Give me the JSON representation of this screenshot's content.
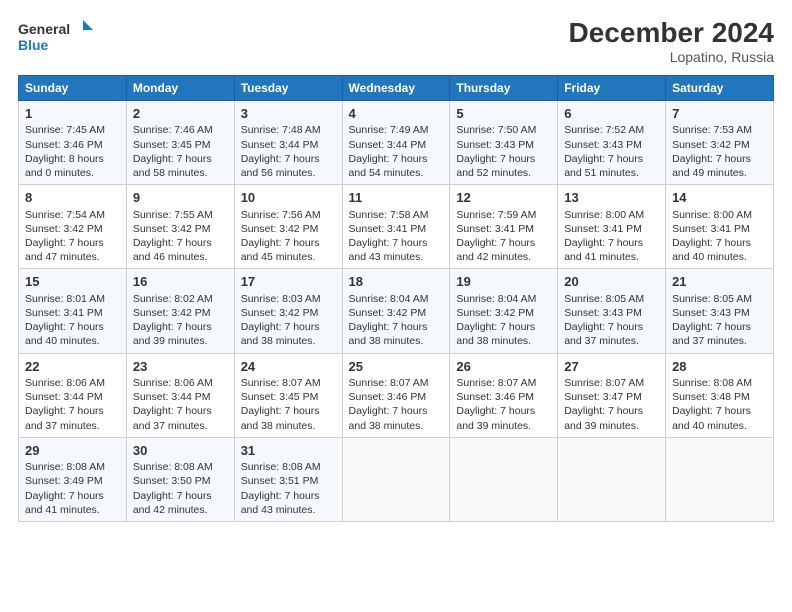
{
  "header": {
    "logo_line1": "General",
    "logo_line2": "Blue",
    "title": "December 2024",
    "subtitle": "Lopatino, Russia"
  },
  "columns": [
    "Sunday",
    "Monday",
    "Tuesday",
    "Wednesday",
    "Thursday",
    "Friday",
    "Saturday"
  ],
  "weeks": [
    [
      {
        "day": "1",
        "lines": [
          "Sunrise: 7:45 AM",
          "Sunset: 3:46 PM",
          "Daylight: 8 hours",
          "and 0 minutes."
        ]
      },
      {
        "day": "2",
        "lines": [
          "Sunrise: 7:46 AM",
          "Sunset: 3:45 PM",
          "Daylight: 7 hours",
          "and 58 minutes."
        ]
      },
      {
        "day": "3",
        "lines": [
          "Sunrise: 7:48 AM",
          "Sunset: 3:44 PM",
          "Daylight: 7 hours",
          "and 56 minutes."
        ]
      },
      {
        "day": "4",
        "lines": [
          "Sunrise: 7:49 AM",
          "Sunset: 3:44 PM",
          "Daylight: 7 hours",
          "and 54 minutes."
        ]
      },
      {
        "day": "5",
        "lines": [
          "Sunrise: 7:50 AM",
          "Sunset: 3:43 PM",
          "Daylight: 7 hours",
          "and 52 minutes."
        ]
      },
      {
        "day": "6",
        "lines": [
          "Sunrise: 7:52 AM",
          "Sunset: 3:43 PM",
          "Daylight: 7 hours",
          "and 51 minutes."
        ]
      },
      {
        "day": "7",
        "lines": [
          "Sunrise: 7:53 AM",
          "Sunset: 3:42 PM",
          "Daylight: 7 hours",
          "and 49 minutes."
        ]
      }
    ],
    [
      {
        "day": "8",
        "lines": [
          "Sunrise: 7:54 AM",
          "Sunset: 3:42 PM",
          "Daylight: 7 hours",
          "and 47 minutes."
        ]
      },
      {
        "day": "9",
        "lines": [
          "Sunrise: 7:55 AM",
          "Sunset: 3:42 PM",
          "Daylight: 7 hours",
          "and 46 minutes."
        ]
      },
      {
        "day": "10",
        "lines": [
          "Sunrise: 7:56 AM",
          "Sunset: 3:42 PM",
          "Daylight: 7 hours",
          "and 45 minutes."
        ]
      },
      {
        "day": "11",
        "lines": [
          "Sunrise: 7:58 AM",
          "Sunset: 3:41 PM",
          "Daylight: 7 hours",
          "and 43 minutes."
        ]
      },
      {
        "day": "12",
        "lines": [
          "Sunrise: 7:59 AM",
          "Sunset: 3:41 PM",
          "Daylight: 7 hours",
          "and 42 minutes."
        ]
      },
      {
        "day": "13",
        "lines": [
          "Sunrise: 8:00 AM",
          "Sunset: 3:41 PM",
          "Daylight: 7 hours",
          "and 41 minutes."
        ]
      },
      {
        "day": "14",
        "lines": [
          "Sunrise: 8:00 AM",
          "Sunset: 3:41 PM",
          "Daylight: 7 hours",
          "and 40 minutes."
        ]
      }
    ],
    [
      {
        "day": "15",
        "lines": [
          "Sunrise: 8:01 AM",
          "Sunset: 3:41 PM",
          "Daylight: 7 hours",
          "and 40 minutes."
        ]
      },
      {
        "day": "16",
        "lines": [
          "Sunrise: 8:02 AM",
          "Sunset: 3:42 PM",
          "Daylight: 7 hours",
          "and 39 minutes."
        ]
      },
      {
        "day": "17",
        "lines": [
          "Sunrise: 8:03 AM",
          "Sunset: 3:42 PM",
          "Daylight: 7 hours",
          "and 38 minutes."
        ]
      },
      {
        "day": "18",
        "lines": [
          "Sunrise: 8:04 AM",
          "Sunset: 3:42 PM",
          "Daylight: 7 hours",
          "and 38 minutes."
        ]
      },
      {
        "day": "19",
        "lines": [
          "Sunrise: 8:04 AM",
          "Sunset: 3:42 PM",
          "Daylight: 7 hours",
          "and 38 minutes."
        ]
      },
      {
        "day": "20",
        "lines": [
          "Sunrise: 8:05 AM",
          "Sunset: 3:43 PM",
          "Daylight: 7 hours",
          "and 37 minutes."
        ]
      },
      {
        "day": "21",
        "lines": [
          "Sunrise: 8:05 AM",
          "Sunset: 3:43 PM",
          "Daylight: 7 hours",
          "and 37 minutes."
        ]
      }
    ],
    [
      {
        "day": "22",
        "lines": [
          "Sunrise: 8:06 AM",
          "Sunset: 3:44 PM",
          "Daylight: 7 hours",
          "and 37 minutes."
        ]
      },
      {
        "day": "23",
        "lines": [
          "Sunrise: 8:06 AM",
          "Sunset: 3:44 PM",
          "Daylight: 7 hours",
          "and 37 minutes."
        ]
      },
      {
        "day": "24",
        "lines": [
          "Sunrise: 8:07 AM",
          "Sunset: 3:45 PM",
          "Daylight: 7 hours",
          "and 38 minutes."
        ]
      },
      {
        "day": "25",
        "lines": [
          "Sunrise: 8:07 AM",
          "Sunset: 3:46 PM",
          "Daylight: 7 hours",
          "and 38 minutes."
        ]
      },
      {
        "day": "26",
        "lines": [
          "Sunrise: 8:07 AM",
          "Sunset: 3:46 PM",
          "Daylight: 7 hours",
          "and 39 minutes."
        ]
      },
      {
        "day": "27",
        "lines": [
          "Sunrise: 8:07 AM",
          "Sunset: 3:47 PM",
          "Daylight: 7 hours",
          "and 39 minutes."
        ]
      },
      {
        "day": "28",
        "lines": [
          "Sunrise: 8:08 AM",
          "Sunset: 3:48 PM",
          "Daylight: 7 hours",
          "and 40 minutes."
        ]
      }
    ],
    [
      {
        "day": "29",
        "lines": [
          "Sunrise: 8:08 AM",
          "Sunset: 3:49 PM",
          "Daylight: 7 hours",
          "and 41 minutes."
        ]
      },
      {
        "day": "30",
        "lines": [
          "Sunrise: 8:08 AM",
          "Sunset: 3:50 PM",
          "Daylight: 7 hours",
          "and 42 minutes."
        ]
      },
      {
        "day": "31",
        "lines": [
          "Sunrise: 8:08 AM",
          "Sunset: 3:51 PM",
          "Daylight: 7 hours",
          "and 43 minutes."
        ]
      },
      null,
      null,
      null,
      null
    ]
  ]
}
